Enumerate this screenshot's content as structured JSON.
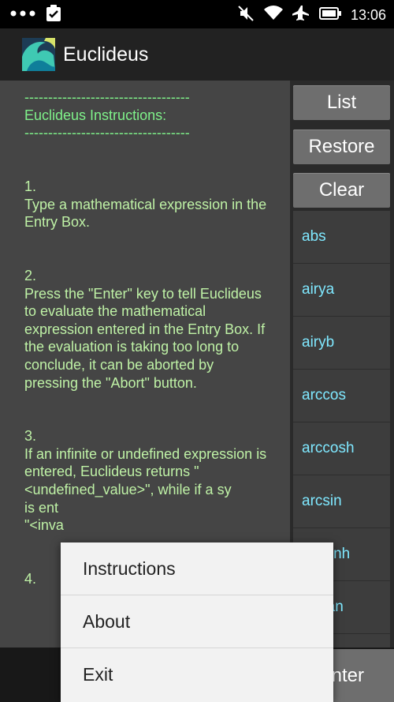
{
  "status_bar": {
    "time": "13:06",
    "left_icons": [
      "more-dots-icon",
      "clipboard-check-icon"
    ],
    "right_icons": [
      "mute-icon",
      "wifi-icon",
      "airplane-icon",
      "battery-icon"
    ]
  },
  "app": {
    "title": "Euclideus",
    "icon": "wave-icon"
  },
  "instructions": {
    "divider": "-----------------------------------",
    "heading": "Euclideus Instructions:",
    "body": "\n\n\n1.\nType a mathematical expression in the Entry Box.\n\n\n2.\nPress the \"Enter\" key to tell Euclideus to evaluate the mathematical expression entered in the Entry Box. If the evaluation is taking too long to conclude, it can be aborted by pressing the \"Abort\" button.\n\n\n3.\nIf an infinite or undefined expression is entered, Euclideus returns \"<undefined_value>\", while if a sy\nis ent\n\"<inva\n\n\n4."
  },
  "side_buttons": {
    "list": "List",
    "restore": "Restore",
    "clear": "Clear"
  },
  "functions": [
    "abs",
    "airya",
    "airyb",
    "arccos",
    "arccosh",
    "arcsin",
    "arcsinh",
    "arctan"
  ],
  "enter_button": "Enter",
  "overflow_menu": {
    "items": [
      "Instructions",
      "About",
      "Exit"
    ]
  },
  "colors": {
    "instruction_text": "#bff2a6",
    "function_text": "#7fe8ff",
    "button_bg": "#6e6e6e"
  }
}
